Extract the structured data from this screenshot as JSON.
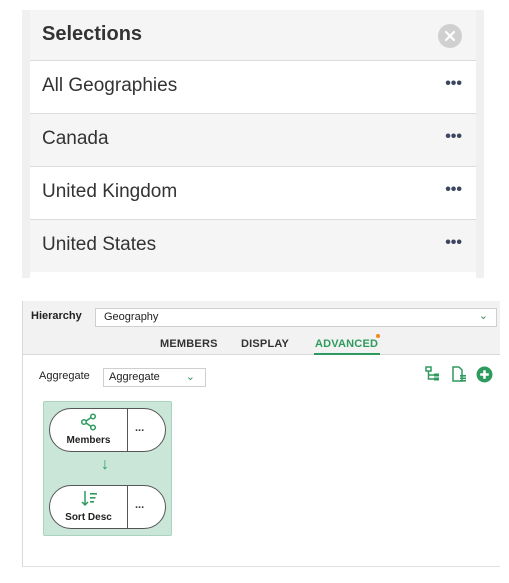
{
  "selections": {
    "title": "Selections",
    "close_icon": "close-circle-icon",
    "items": [
      {
        "label": "All Geographies",
        "more": "•••"
      },
      {
        "label": "Canada",
        "more": "•••"
      },
      {
        "label": "United Kingdom",
        "more": "•••"
      },
      {
        "label": "United States",
        "more": "•••"
      }
    ]
  },
  "hierarchy": {
    "label": "Hierarchy",
    "value": "Geography",
    "chevron": "⌄"
  },
  "tabs": [
    {
      "label": "MEMBERS",
      "active": false
    },
    {
      "label": "DISPLAY",
      "active": false
    },
    {
      "label": "ADVANCED",
      "active": true
    }
  ],
  "aggregate": {
    "label": "Aggregate",
    "value": "Aggregate",
    "chevron": "⌄"
  },
  "toolbar_icons": [
    "tree-icon",
    "document-list-icon",
    "add-circle-icon"
  ],
  "flow": {
    "steps": [
      {
        "label": "Members",
        "icon": "share-nodes-icon",
        "more": "..."
      },
      {
        "label": "Sort Desc",
        "icon": "sort-desc-icon",
        "more": "..."
      }
    ],
    "arrow": "↓"
  },
  "colors": {
    "accent": "#2e9b5e",
    "flow_bg": "#c9e6d9",
    "badge": "#f28a1c"
  }
}
